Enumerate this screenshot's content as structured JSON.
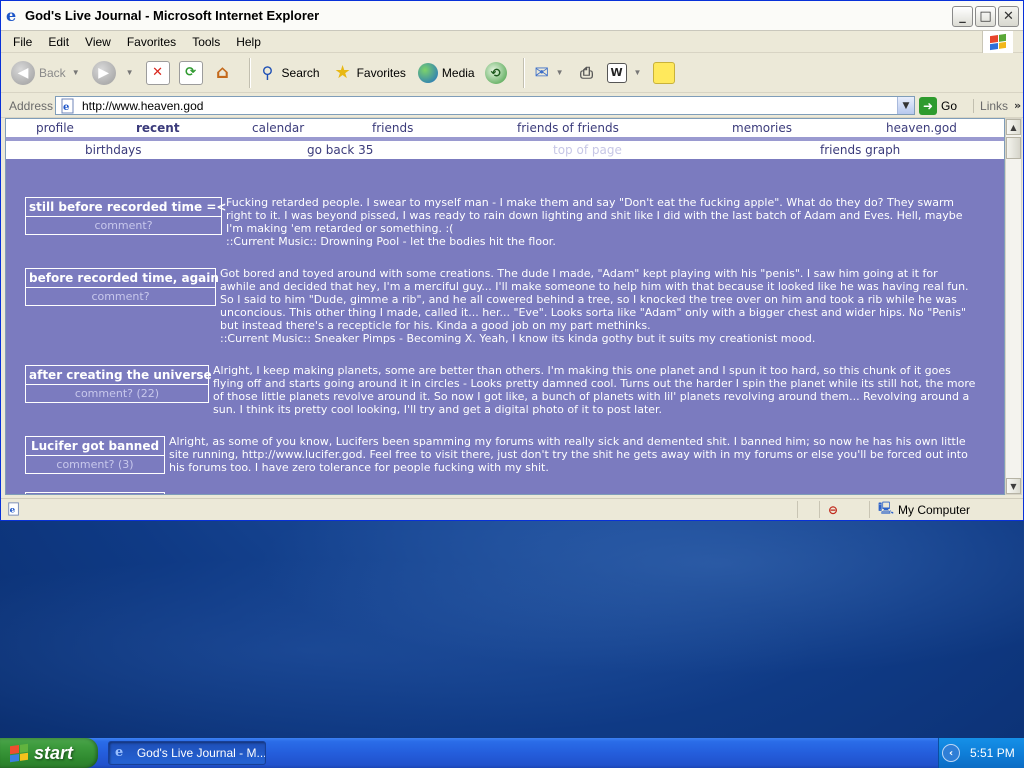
{
  "window": {
    "title": "God's Live Journal - Microsoft Internet Explorer",
    "buttons": {
      "minimize": "_",
      "maximize": "□",
      "close": "✕"
    }
  },
  "menu": [
    "File",
    "Edit",
    "View",
    "Favorites",
    "Tools",
    "Help"
  ],
  "toolbar": {
    "back": "Back",
    "search": "Search",
    "favorites": "Favorites",
    "media": "Media"
  },
  "address": {
    "label": "Address",
    "url": "http://www.heaven.god",
    "go": "Go",
    "links": "Links"
  },
  "nav_primary": [
    "profile",
    "recent",
    "calendar",
    "friends",
    "friends of friends",
    "memories",
    "heaven.god"
  ],
  "nav_secondary": [
    "birthdays",
    "go back 35",
    "top of page",
    "friends graph"
  ],
  "entries": [
    {
      "title": "still before recorded time =<",
      "comment": "comment?",
      "text": [
        "Fucking retarded people. I swear to myself man - I make them and say \"Don't eat the fucking apple\". What do they do? They swarm right to it. I was beyond pissed, I was ready to rain down lighting and shit like I did with the last batch of Adam and Eves. Hell, maybe I'm making 'em retarded or something. :(",
        "::Current Music:: Drowning Pool - let the bodies hit the floor."
      ]
    },
    {
      "title": "before recorded time, again",
      "comment": "comment?",
      "text": [
        "Got bored and toyed around with some creations. The dude I made, \"Adam\" kept playing with his \"penis\". I saw him going at it for awhile and decided that hey, I'm a merciful guy... I'll make someone to help him with that because it looked like he was having real fun. So I said to him \"Dude, gimme a rib\", and he all cowered behind a tree, so I knocked the tree over on him and took a rib while he was unconcious. This other thing I made, called it... her... \"Eve\". Looks sorta like \"Adam\" only with a bigger chest and wider hips. No \"Penis\" but instead there's a recepticle for his. Kinda a good job on my part methinks.",
        "::Current Music:: Sneaker Pimps - Becoming X. Yeah, I know its kinda gothy but it suits my creationist mood."
      ]
    },
    {
      "title": "after creating the universe",
      "comment": "comment? (22)",
      "text": [
        "Alright, I keep making planets, some are better than others. I'm making this one planet and I spun it too hard, so this chunk of it goes flying off and starts going around it in circles - Looks pretty damned cool. Turns out the harder I spin the planet while its still hot, the more of those little planets revolve around it. So now I got like, a bunch of planets with lil' planets revolving around them... Revolving around a sun. I think its pretty cool looking, I'll try and get a digital photo of it to post later."
      ]
    },
    {
      "title": "Lucifer got banned",
      "comment": "comment? (3)",
      "text": [
        "Alright, as some of you know, Lucifers been spamming my forums with really sick and demented shit. I banned him; so now he has his own little site running, http://www.lucifer.god. Feel free to visit there, just don't try the shit he gets away with in my forums or else you'll be forced out into his forums too. I have zero tolerance for people fucking with my shit."
      ]
    }
  ],
  "status": {
    "zone": "My Computer"
  },
  "taskbar": {
    "start": "start",
    "task": "God's Live Journal - M...",
    "clock": "5:51 PM"
  },
  "colors": {
    "page_bg": "#7b7bbf",
    "nav_text": "#3b3b7b",
    "title_bar": "#fbfbf8",
    "taskbar": "#245edc",
    "start_green": "#3c9a3c"
  }
}
